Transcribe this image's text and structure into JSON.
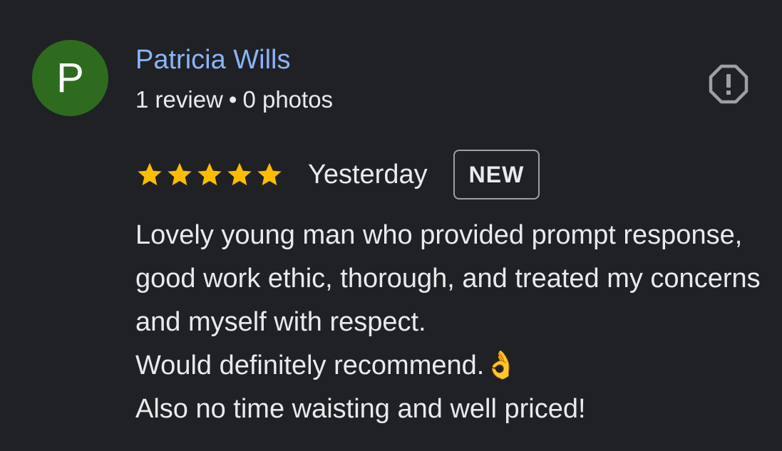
{
  "review": {
    "author": {
      "initial": "P",
      "name": "Patricia Wills",
      "review_count": "1 review",
      "separator": "•",
      "photo_count": "0 photos",
      "avatar_color": "#2e6b1f",
      "name_color": "#8ab4f8"
    },
    "report": {
      "icon": "report-icon"
    },
    "rating": {
      "stars": 5,
      "max_stars": 5,
      "star_color": "#fbbc04",
      "icon": "star-icon"
    },
    "date": "Yesterday",
    "badge": "NEW",
    "text": "Lovely young man who provided prompt response, good work ethic, thorough, and treated my concerns and myself with respect.\nWould definitely recommend.👌\nAlso no time waisting and well priced!"
  }
}
